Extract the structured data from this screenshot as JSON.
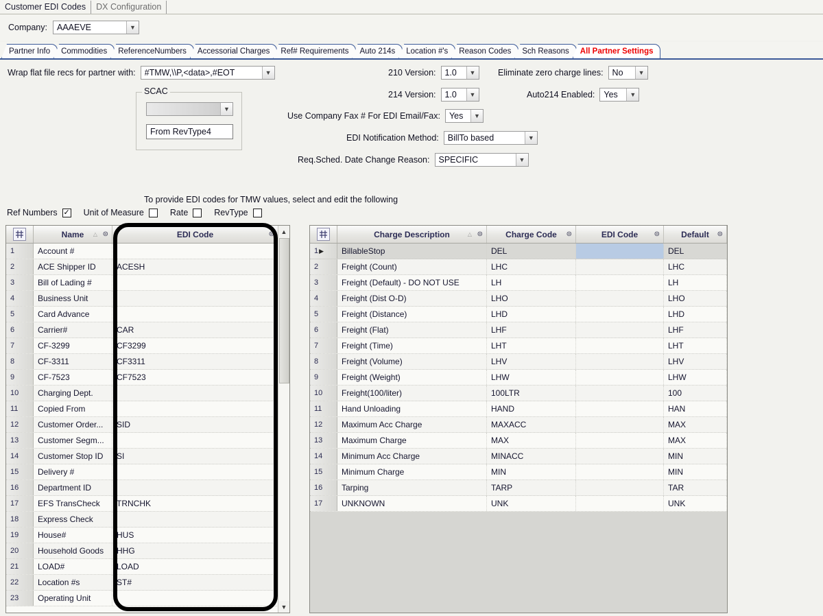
{
  "window_tabs": [
    {
      "label": "Customer EDI Codes",
      "active": true
    },
    {
      "label": "DX Configuration",
      "active": false
    }
  ],
  "company": {
    "label": "Company:",
    "value": "AAAEVE",
    "dropdown_icon": "chevron-down-icon"
  },
  "tabs": [
    {
      "label": "Partner Info",
      "active": false
    },
    {
      "label": "Commodities",
      "active": false
    },
    {
      "label": "ReferenceNumbers",
      "active": false
    },
    {
      "label": "Accessorial Charges",
      "active": false
    },
    {
      "label": "Ref# Requirements",
      "active": false
    },
    {
      "label": "Auto 214s",
      "active": false
    },
    {
      "label": "Location #'s",
      "active": false
    },
    {
      "label": "Reason Codes",
      "active": false
    },
    {
      "label": "Sch Reasons",
      "active": false
    },
    {
      "label": "All Partner Settings",
      "active": true
    }
  ],
  "settings": {
    "wrap": {
      "label": "Wrap flat file recs for partner with:",
      "value": "#TMW,\\\\P,<data>,#EOT"
    },
    "scac": {
      "legend": "SCAC",
      "select_value": "",
      "text_value": "From RevType4"
    },
    "v210": {
      "label": "210 Version:",
      "value": "1.0"
    },
    "v214": {
      "label": "214 Version:",
      "value": "1.0"
    },
    "fax": {
      "label": "Use Company Fax # For EDI Email/Fax:",
      "value": "Yes"
    },
    "notify": {
      "label": "EDI Notification Method:",
      "value": "BillTo based"
    },
    "reason": {
      "label": "Req.Sched. Date Change Reason:",
      "value": "SPECIFIC"
    },
    "zero_charge": {
      "label": "Eliminate zero charge lines:",
      "value": "No"
    },
    "auto214": {
      "label": "Auto214 Enabled:",
      "value": "Yes"
    }
  },
  "hint": "To provide EDI codes for TMW values, select and edit the following",
  "checkboxes": [
    {
      "label": "Ref Numbers",
      "checked": true
    },
    {
      "label": "Unit of Measure",
      "checked": false
    },
    {
      "label": "Rate",
      "checked": false
    },
    {
      "label": "RevType",
      "checked": false
    }
  ],
  "left_grid": {
    "columns": [
      "Name",
      "EDI Code"
    ],
    "sort_column": "Name",
    "rows": [
      {
        "n": "1",
        "name": "Account #",
        "edi": ""
      },
      {
        "n": "2",
        "name": "ACE Shipper ID",
        "edi": "ACESH"
      },
      {
        "n": "3",
        "name": "Bill of Lading #",
        "edi": ""
      },
      {
        "n": "4",
        "name": "Business Unit",
        "edi": ""
      },
      {
        "n": "5",
        "name": "Card Advance",
        "edi": ""
      },
      {
        "n": "6",
        "name": "Carrier#",
        "edi": "CAR"
      },
      {
        "n": "7",
        "name": "CF-3299",
        "edi": "CF3299"
      },
      {
        "n": "8",
        "name": "CF-3311",
        "edi": "CF3311"
      },
      {
        "n": "9",
        "name": "CF-7523",
        "edi": "CF7523"
      },
      {
        "n": "10",
        "name": "Charging Dept.",
        "edi": ""
      },
      {
        "n": "11",
        "name": "Copied From",
        "edi": ""
      },
      {
        "n": "12",
        "name": "Customer Order...",
        "edi": "SID"
      },
      {
        "n": "13",
        "name": "Customer Segm...",
        "edi": ""
      },
      {
        "n": "14",
        "name": "Customer Stop ID",
        "edi": "SI"
      },
      {
        "n": "15",
        "name": "Delivery #",
        "edi": ""
      },
      {
        "n": "16",
        "name": "Department ID",
        "edi": ""
      },
      {
        "n": "17",
        "name": "EFS TransCheck",
        "edi": "TRNCHK"
      },
      {
        "n": "18",
        "name": "Express Check",
        "edi": ""
      },
      {
        "n": "19",
        "name": "House#",
        "edi": "HUS"
      },
      {
        "n": "20",
        "name": "Household Goods",
        "edi": "HHG"
      },
      {
        "n": "21",
        "name": "LOAD#",
        "edi": "LOAD"
      },
      {
        "n": "22",
        "name": "Location #s",
        "edi": "ST#"
      },
      {
        "n": "23",
        "name": "Operating Unit",
        "edi": ""
      }
    ]
  },
  "right_grid": {
    "columns": [
      "Charge Description",
      "Charge Code",
      "EDI Code",
      "Default"
    ],
    "sort_column": "Charge Description",
    "rows": [
      {
        "n": "1",
        "desc": "BillableStop",
        "code": "DEL",
        "edi": "",
        "def": "DEL",
        "selected": true
      },
      {
        "n": "2",
        "desc": "Freight (Count)",
        "code": "LHC",
        "edi": "",
        "def": "LHC"
      },
      {
        "n": "3",
        "desc": "Freight (Default) - DO NOT USE",
        "code": "LH",
        "edi": "",
        "def": "LH"
      },
      {
        "n": "4",
        "desc": "Freight (Dist O-D)",
        "code": "LHO",
        "edi": "",
        "def": "LHO"
      },
      {
        "n": "5",
        "desc": "Freight (Distance)",
        "code": "LHD",
        "edi": "",
        "def": "LHD"
      },
      {
        "n": "6",
        "desc": "Freight (Flat)",
        "code": "LHF",
        "edi": "",
        "def": "LHF"
      },
      {
        "n": "7",
        "desc": "Freight (Time)",
        "code": "LHT",
        "edi": "",
        "def": "LHT"
      },
      {
        "n": "8",
        "desc": "Freight (Volume)",
        "code": "LHV",
        "edi": "",
        "def": "LHV"
      },
      {
        "n": "9",
        "desc": "Freight (Weight)",
        "code": "LHW",
        "edi": "",
        "def": "LHW"
      },
      {
        "n": "10",
        "desc": "Freight(100/liter)",
        "code": "100LTR",
        "edi": "",
        "def": "100"
      },
      {
        "n": "11",
        "desc": "Hand Unloading",
        "code": "HAND",
        "edi": "",
        "def": "HAN"
      },
      {
        "n": "12",
        "desc": "Maximum Acc Charge",
        "code": "MAXACC",
        "edi": "",
        "def": "MAX"
      },
      {
        "n": "13",
        "desc": "Maximum Charge",
        "code": "MAX",
        "edi": "",
        "def": "MAX"
      },
      {
        "n": "14",
        "desc": "Minimum Acc Charge",
        "code": "MINACC",
        "edi": "",
        "def": "MIN"
      },
      {
        "n": "15",
        "desc": "Minimum Charge",
        "code": "MIN",
        "edi": "",
        "def": "MIN"
      },
      {
        "n": "16",
        "desc": "Tarping",
        "code": "TARP",
        "edi": "",
        "def": "TAR"
      },
      {
        "n": "17",
        "desc": "UNKNOWN",
        "code": "UNK",
        "edi": "",
        "def": "UNK"
      }
    ]
  },
  "colors": {
    "active_tab_text": "#ee0000",
    "tab_border": "#3b5998",
    "header_text": "#2c2c55",
    "selected_cell": "#b8cbe4",
    "annotation": "#000000"
  }
}
